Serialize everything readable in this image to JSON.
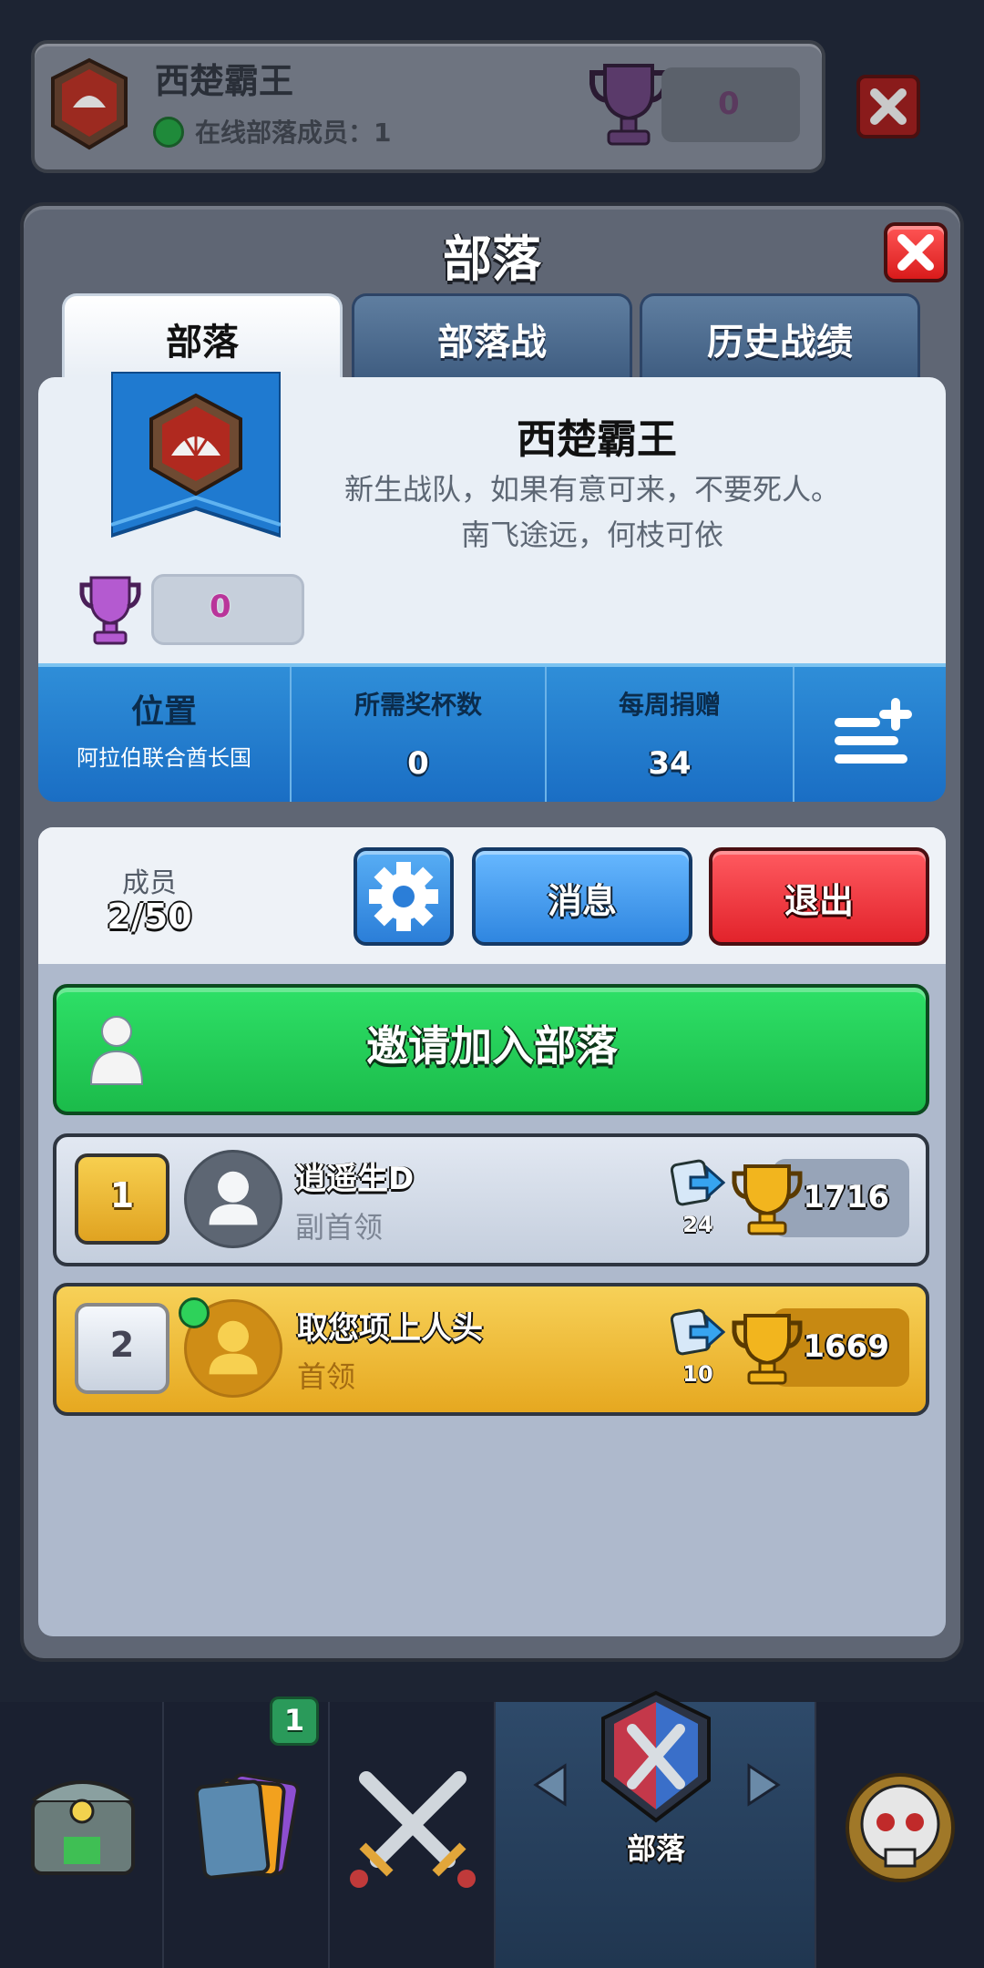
{
  "top_header": {
    "clan_name": "西楚霸王",
    "online_label": "在线部落成员：1",
    "trophies": "0"
  },
  "panel": {
    "title": "部落"
  },
  "tabs": [
    {
      "label": "部落",
      "active": true
    },
    {
      "label": "部落战",
      "active": false
    },
    {
      "label": "历史战绩",
      "active": false
    }
  ],
  "clan": {
    "name": "西楚霸王",
    "description_line1": "新生战队，如果有意可来，不要死人。",
    "description_line2": "南飞途远，何枝可依",
    "trophies": "0"
  },
  "stats": {
    "location_label": "位置",
    "location_value": "阿拉伯联合酋长国",
    "required_trophies_label": "所需奖杯数",
    "required_trophies_value": "0",
    "weekly_donations_label": "每周捐赠",
    "weekly_donations_value": "34"
  },
  "members_section": {
    "label": "成员",
    "count": "2/50",
    "message_button": "消息",
    "exit_button": "退出",
    "invite_button": "邀请加入部落"
  },
  "members": [
    {
      "rank": "1",
      "name": "逍遥生D",
      "role": "副首领",
      "donations": "24",
      "trophies": "1716"
    },
    {
      "rank": "2",
      "name": "取您项上人头",
      "role": "首领",
      "donations": "10",
      "trophies": "1669"
    }
  ],
  "bottom_nav": {
    "active_label": "部落",
    "cards_badge": "1"
  },
  "colors": {
    "accent_blue": "#2b7ed8",
    "exit_red": "#e2232b",
    "invite_green": "#1bbb4a",
    "gold": "#e6a820"
  }
}
